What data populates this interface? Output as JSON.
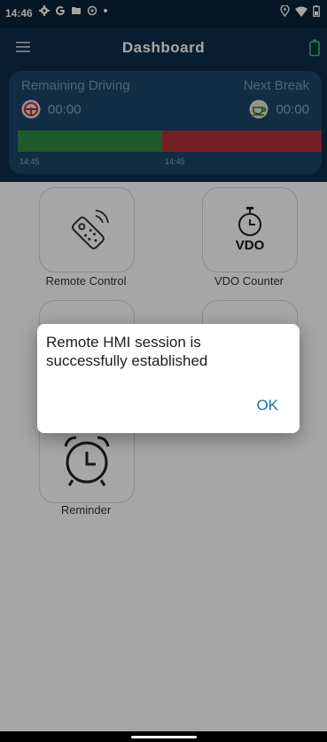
{
  "status_bar": {
    "time": "14:46",
    "left_icons": [
      "gear-icon",
      "google-g-icon",
      "file-icon",
      "settings-icon",
      "dot-icon"
    ],
    "right_icons": [
      "location-icon",
      "wifi-icon",
      "battery-icon"
    ]
  },
  "app_bar": {
    "title": "Dashboard",
    "menu_icon": "hamburger-icon",
    "battery_icon": "battery-outline-icon",
    "accent": "#34c759"
  },
  "driving_panel": {
    "remaining_label": "Remaining Driving",
    "remaining_value": "00:00",
    "next_break_label": "Next Break",
    "next_break_value": "00:00",
    "progress_start_time": "14:45",
    "progress_split_time": "14:45",
    "drive_color": "#2e8d42",
    "rest_color": "#b2313c"
  },
  "tiles": [
    {
      "label": "Remote Control",
      "icon": "remote-control-icon"
    },
    {
      "label": "VDO Counter",
      "icon": "vdo-stopwatch-icon",
      "icon_text": "VDO"
    },
    {
      "label": "",
      "icon": "tablet-icon"
    },
    {
      "label": "",
      "icon": "truck-icon"
    },
    {
      "label": "Reminder",
      "icon": "alarm-clock-icon"
    }
  ],
  "dialog": {
    "message": "Remote HMI session is successfully established",
    "ok_label": "OK"
  }
}
